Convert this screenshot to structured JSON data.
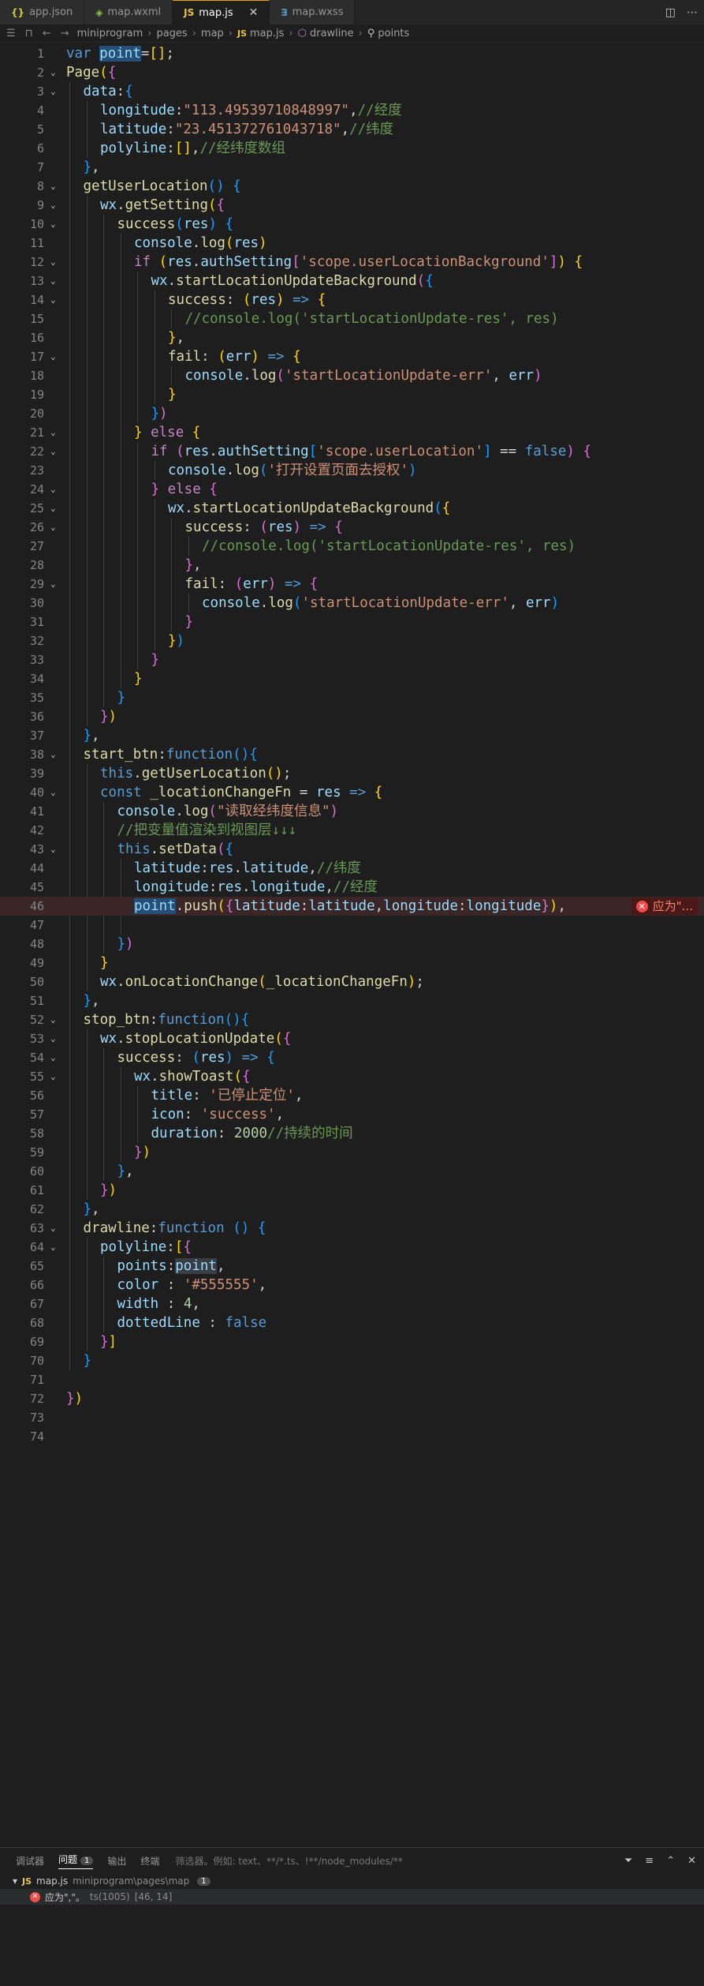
{
  "tabs": [
    {
      "label": "app.json",
      "icon": "{}"
    },
    {
      "label": "map.wxml",
      "icon": "◈"
    },
    {
      "label": "map.js",
      "icon": "JS",
      "active": true
    },
    {
      "label": "map.wxss",
      "icon": "∃"
    }
  ],
  "tab_close": "✕",
  "breadcrumb": {
    "items": [
      "miniprogram",
      "pages",
      "map",
      "map.js",
      "drawline",
      "points"
    ]
  },
  "error_badge": "应为\"...",
  "code_lines": [
    {
      "n": "1",
      "indent": 0,
      "fold": "",
      "html": "<span class='kw'>var</span> <span class='var hl'>point</span><span class='pn'>=</span><span class='p1'>[]</span><span class='pn'>;</span>"
    },
    {
      "n": "2",
      "indent": 0,
      "fold": "v",
      "html": "<span class='fn'>Page</span><span class='p1'>(</span><span class='p2'>{</span>"
    },
    {
      "n": "3",
      "indent": 1,
      "fold": "v",
      "html": "<span class='var'>data</span><span class='pn'>:</span><span class='p3'>{</span>"
    },
    {
      "n": "4",
      "indent": 2,
      "fold": "",
      "html": "<span class='var'>longitude</span><span class='pn'>:</span><span class='str'>\"113.49539710848997\"</span><span class='pn'>,</span><span class='cm'>//经度</span>"
    },
    {
      "n": "5",
      "indent": 2,
      "fold": "",
      "html": "<span class='var'>latitude</span><span class='pn'>:</span><span class='str'>\"23.451372761043718\"</span><span class='pn'>,</span><span class='cm'>//纬度</span>"
    },
    {
      "n": "6",
      "indent": 2,
      "fold": "",
      "html": "<span class='var'>polyline</span><span class='pn'>:</span><span class='p1'>[]</span><span class='pn'>,</span><span class='cm'>//经纬度数组</span>"
    },
    {
      "n": "7",
      "indent": 1,
      "fold": "",
      "html": "<span class='p3'>}</span><span class='pn'>,</span>"
    },
    {
      "n": "8",
      "indent": 1,
      "fold": "v",
      "html": "<span class='fn'>getUserLocation</span><span class='p3'>()</span> <span class='p3'>{</span>"
    },
    {
      "n": "9",
      "indent": 2,
      "fold": "v",
      "html": "<span class='var'>wx</span><span class='pn'>.</span><span class='fn'>getSetting</span><span class='p1'>(</span><span class='p2'>{</span>"
    },
    {
      "n": "10",
      "indent": 3,
      "fold": "v",
      "html": "<span class='fn'>success</span><span class='p3'>(</span><span class='var'>res</span><span class='p3'>)</span> <span class='p3'>{</span>"
    },
    {
      "n": "11",
      "indent": 4,
      "fold": "",
      "html": "<span class='var'>console</span><span class='pn'>.</span><span class='fn'>log</span><span class='p1'>(</span><span class='var'>res</span><span class='p1'>)</span>"
    },
    {
      "n": "12",
      "indent": 4,
      "fold": "v",
      "html": "<span class='ctl'>if</span> <span class='p1'>(</span><span class='var'>res</span><span class='pn'>.</span><span class='var'>authSetting</span><span class='p2'>[</span><span class='str'>'scope.userLocationBackground'</span><span class='p2'>]</span><span class='p1'>)</span> <span class='p1'>{</span>"
    },
    {
      "n": "13",
      "indent": 5,
      "fold": "v",
      "html": "<span class='var'>wx</span><span class='pn'>.</span><span class='fn'>startLocationUpdateBackground</span><span class='p2'>(</span><span class='p3'>{</span>"
    },
    {
      "n": "14",
      "indent": 6,
      "fold": "v",
      "html": "<span class='fn'>success</span><span class='pn'>:</span> <span class='p1'>(</span><span class='var'>res</span><span class='p1'>)</span> <span class='kw'>=></span> <span class='p1'>{</span>"
    },
    {
      "n": "15",
      "indent": 7,
      "fold": "",
      "html": "<span class='cm'>//console.log('startLocationUpdate-res', res)</span>"
    },
    {
      "n": "16",
      "indent": 6,
      "fold": "",
      "html": "<span class='p1'>}</span><span class='pn'>,</span>"
    },
    {
      "n": "17",
      "indent": 6,
      "fold": "v",
      "html": "<span class='fn'>fail</span><span class='pn'>:</span> <span class='p1'>(</span><span class='var'>err</span><span class='p1'>)</span> <span class='kw'>=></span> <span class='p1'>{</span>"
    },
    {
      "n": "18",
      "indent": 7,
      "fold": "",
      "html": "<span class='var'>console</span><span class='pn'>.</span><span class='fn'>log</span><span class='p2'>(</span><span class='str'>'startLocationUpdate-err'</span><span class='pn'>,</span> <span class='var'>err</span><span class='p2'>)</span>"
    },
    {
      "n": "19",
      "indent": 6,
      "fold": "",
      "html": "<span class='p1'>}</span>"
    },
    {
      "n": "20",
      "indent": 5,
      "fold": "",
      "html": "<span class='p3'>}</span><span class='p2'>)</span>"
    },
    {
      "n": "21",
      "indent": 4,
      "fold": "v",
      "html": "<span class='p1'>}</span> <span class='ctl'>else</span> <span class='p1'>{</span>"
    },
    {
      "n": "22",
      "indent": 5,
      "fold": "v",
      "html": "<span class='ctl'>if</span> <span class='p2'>(</span><span class='var'>res</span><span class='pn'>.</span><span class='var'>authSetting</span><span class='p3'>[</span><span class='str'>'scope.userLocation'</span><span class='p3'>]</span> <span class='pn'>==</span> <span class='kw'>false</span><span class='p2'>)</span> <span class='p2'>{</span>"
    },
    {
      "n": "23",
      "indent": 6,
      "fold": "",
      "html": "<span class='var'>console</span><span class='pn'>.</span><span class='fn'>log</span><span class='p3'>(</span><span class='str'>'打开设置页面去授权'</span><span class='p3'>)</span>"
    },
    {
      "n": "24",
      "indent": 5,
      "fold": "v",
      "html": "<span class='p2'>}</span> <span class='ctl'>else</span> <span class='p2'>{</span>"
    },
    {
      "n": "25",
      "indent": 6,
      "fold": "v",
      "html": "<span class='var'>wx</span><span class='pn'>.</span><span class='fn'>startLocationUpdateBackground</span><span class='p3'>(</span><span class='p1'>{</span>"
    },
    {
      "n": "26",
      "indent": 7,
      "fold": "v",
      "html": "<span class='fn'>success</span><span class='pn'>:</span> <span class='p2'>(</span><span class='var'>res</span><span class='p2'>)</span> <span class='kw'>=></span> <span class='p2'>{</span>"
    },
    {
      "n": "27",
      "indent": 8,
      "fold": "",
      "html": "<span class='cm'>//console.log('startLocationUpdate-res', res)</span>"
    },
    {
      "n": "28",
      "indent": 7,
      "fold": "",
      "html": "<span class='p2'>}</span><span class='pn'>,</span>"
    },
    {
      "n": "29",
      "indent": 7,
      "fold": "v",
      "html": "<span class='fn'>fail</span><span class='pn'>:</span> <span class='p2'>(</span><span class='var'>err</span><span class='p2'>)</span> <span class='kw'>=></span> <span class='p2'>{</span>"
    },
    {
      "n": "30",
      "indent": 8,
      "fold": "",
      "html": "<span class='var'>console</span><span class='pn'>.</span><span class='fn'>log</span><span class='p3'>(</span><span class='str'>'startLocationUpdate-err'</span><span class='pn'>,</span> <span class='var'>err</span><span class='p3'>)</span>"
    },
    {
      "n": "31",
      "indent": 7,
      "fold": "",
      "html": "<span class='p2'>}</span>"
    },
    {
      "n": "32",
      "indent": 6,
      "fold": "",
      "html": "<span class='p1'>}</span><span class='p3'>)</span>"
    },
    {
      "n": "33",
      "indent": 5,
      "fold": "",
      "html": "<span class='p2'>}</span>"
    },
    {
      "n": "34",
      "indent": 4,
      "fold": "",
      "html": "<span class='p1'>}</span>"
    },
    {
      "n": "35",
      "indent": 3,
      "fold": "",
      "html": "<span class='p3'>}</span>"
    },
    {
      "n": "36",
      "indent": 2,
      "fold": "",
      "html": "<span class='p2'>}</span><span class='p1'>)</span>"
    },
    {
      "n": "37",
      "indent": 1,
      "fold": "",
      "html": "<span class='p3'>}</span><span class='pn'>,</span>"
    },
    {
      "n": "38",
      "indent": 1,
      "fold": "v",
      "html": "<span class='fn'>start_btn</span><span class='pn'>:</span><span class='kw'>function</span><span class='p3'>()</span><span class='p3'>{</span>"
    },
    {
      "n": "39",
      "indent": 2,
      "fold": "",
      "html": "<span class='kw'>this</span><span class='pn'>.</span><span class='fn'>getUserLocation</span><span class='p1'>()</span><span class='pn'>;</span>"
    },
    {
      "n": "40",
      "indent": 2,
      "fold": "v",
      "html": "<span class='kw'>const</span> <span class='fn'>_locationChangeFn</span> <span class='pn'>=</span> <span class='var'>res</span> <span class='kw'>=></span> <span class='p1'>{</span>"
    },
    {
      "n": "41",
      "indent": 3,
      "fold": "",
      "html": "<span class='var'>console</span><span class='pn'>.</span><span class='fn'>log</span><span class='p2'>(</span><span class='str'>\"读取经纬度信息\"</span><span class='p2'>)</span>"
    },
    {
      "n": "42",
      "indent": 3,
      "fold": "",
      "html": "<span class='cm'>//把变量值渲染到视图层↓↓↓</span>"
    },
    {
      "n": "43",
      "indent": 3,
      "fold": "v",
      "html": "<span class='kw'>this</span><span class='pn'>.</span><span class='fn'>setData</span><span class='p2'>(</span><span class='p3'>{</span>"
    },
    {
      "n": "44",
      "indent": 4,
      "fold": "",
      "html": "<span class='var'>latitude</span><span class='pn'>:</span><span class='var'>res</span><span class='pn'>.</span><span class='var'>latitude</span><span class='pn'>,</span><span class='cm'>//纬度</span>"
    },
    {
      "n": "45",
      "indent": 4,
      "fold": "",
      "html": "<span class='var'>longitude</span><span class='pn'>:</span><span class='var'>res</span><span class='pn'>.</span><span class='var'>longitude</span><span class='pn'>,</span><span class='cm'>//经度</span>"
    },
    {
      "n": "46",
      "indent": 4,
      "fold": "",
      "err": true,
      "html": "<span class='var hl'>point</span><span class='pn'>.</span><span class='fn'>push</span><span class='p1'>(</span><span class='p2'>{</span><span class='var'>latitude</span><span class='pn'>:</span><span class='var'>latitude</span><span class='pn'>,</span><span class='var'>longitude</span><span class='pn'>:</span><span class='var'>longitude</span><span class='p2'>}</span><span class='p1'>)</span><span class='pn'>,</span>"
    },
    {
      "n": "47",
      "indent": 4,
      "fold": "",
      "html": ""
    },
    {
      "n": "48",
      "indent": 3,
      "fold": "",
      "html": "<span class='p3'>}</span><span class='p2'>)</span>"
    },
    {
      "n": "49",
      "indent": 2,
      "fold": "",
      "html": "<span class='p1'>}</span>"
    },
    {
      "n": "50",
      "indent": 2,
      "fold": "",
      "html": "<span class='var'>wx</span><span class='pn'>.</span><span class='fn'>onLocationChange</span><span class='p1'>(</span><span class='fn'>_locationChangeFn</span><span class='p1'>)</span><span class='pn'>;</span>"
    },
    {
      "n": "51",
      "indent": 1,
      "fold": "",
      "html": "<span class='p3'>}</span><span class='pn'>,</span>"
    },
    {
      "n": "52",
      "indent": 1,
      "fold": "v",
      "html": "<span class='fn'>stop_btn</span><span class='pn'>:</span><span class='kw'>function</span><span class='p3'>()</span><span class='p3'>{</span>"
    },
    {
      "n": "53",
      "indent": 2,
      "fold": "v",
      "html": "<span class='var'>wx</span><span class='pn'>.</span><span class='fn'>stopLocationUpdate</span><span class='p1'>(</span><span class='p2'>{</span>"
    },
    {
      "n": "54",
      "indent": 3,
      "fold": "v",
      "html": "<span class='fn'>success</span><span class='pn'>:</span> <span class='p3'>(</span><span class='var'>res</span><span class='p3'>)</span> <span class='kw'>=></span> <span class='p3'>{</span>"
    },
    {
      "n": "55",
      "indent": 4,
      "fold": "v",
      "html": "<span class='var'>wx</span><span class='pn'>.</span><span class='fn'>showToast</span><span class='p1'>(</span><span class='p2'>{</span>"
    },
    {
      "n": "56",
      "indent": 5,
      "fold": "",
      "html": "<span class='var'>title</span><span class='pn'>:</span> <span class='str'>'已停止定位'</span><span class='pn'>,</span>"
    },
    {
      "n": "57",
      "indent": 5,
      "fold": "",
      "html": "<span class='var'>icon</span><span class='pn'>:</span> <span class='str'>'success'</span><span class='pn'>,</span>"
    },
    {
      "n": "58",
      "indent": 5,
      "fold": "",
      "html": "<span class='var'>duration</span><span class='pn'>:</span> <span class='num'>2000</span><span class='cm'>//持续的时间</span>"
    },
    {
      "n": "59",
      "indent": 4,
      "fold": "",
      "html": "<span class='p2'>}</span><span class='p1'>)</span>"
    },
    {
      "n": "60",
      "indent": 3,
      "fold": "",
      "html": "<span class='p3'>}</span><span class='pn'>,</span>"
    },
    {
      "n": "61",
      "indent": 2,
      "fold": "",
      "html": "<span class='p2'>}</span><span class='p1'>)</span>"
    },
    {
      "n": "62",
      "indent": 1,
      "fold": "",
      "html": "<span class='p3'>}</span><span class='pn'>,</span>"
    },
    {
      "n": "63",
      "indent": 1,
      "fold": "v",
      "html": "<span class='fn'>drawline</span><span class='pn'>:</span><span class='kw'>function</span> <span class='p3'>()</span> <span class='p3'>{</span>"
    },
    {
      "n": "64",
      "indent": 2,
      "fold": "v",
      "html": "<span class='var'>polyline</span><span class='pn'>:</span><span class='p1'>[</span><span class='p2'>{</span>"
    },
    {
      "n": "65",
      "indent": 3,
      "fold": "",
      "html": "<span class='var'>points</span><span class='pn'>:</span><span class='var sel'>point</span><span class='pn'>,</span>"
    },
    {
      "n": "66",
      "indent": 3,
      "fold": "",
      "html": "<span class='var'>color</span> <span class='pn'>:</span> <span class='str'>'#555555'</span><span class='pn'>,</span>"
    },
    {
      "n": "67",
      "indent": 3,
      "fold": "",
      "html": "<span class='var'>width</span> <span class='pn'>:</span> <span class='num'>4</span><span class='pn'>,</span>"
    },
    {
      "n": "68",
      "indent": 3,
      "fold": "",
      "html": "<span class='var'>dottedLine</span> <span class='pn'>:</span> <span class='kw'>false</span>"
    },
    {
      "n": "69",
      "indent": 2,
      "fold": "",
      "html": "<span class='p2'>}</span><span class='p1'>]</span>"
    },
    {
      "n": "70",
      "indent": 1,
      "fold": "",
      "html": "<span class='p3'>}</span>"
    },
    {
      "n": "71",
      "indent": 0,
      "fold": "",
      "html": ""
    },
    {
      "n": "72",
      "indent": 0,
      "fold": "",
      "html": "<span class='p2'>}</span><span class='p1'>)</span>"
    },
    {
      "n": "73",
      "indent": 0,
      "fold": "",
      "html": ""
    },
    {
      "n": "74",
      "indent": 0,
      "fold": "",
      "html": ""
    }
  ],
  "panel": {
    "tabs": [
      "调试器",
      "问题",
      "输出",
      "终端"
    ],
    "problem_count": "1",
    "filter_placeholder": "筛选器。例如: text、**/*.ts、!**/node_modules/**",
    "file_name": "map.js",
    "file_path": "miniprogram\\pages\\map",
    "file_count": "1",
    "problem_text": "应为\",\"。",
    "problem_code": "ts(1005)",
    "problem_loc": "[46, 14]"
  },
  "colors": {
    "background": "#1e1e1e",
    "keyword": "#569cd6",
    "function": "#dcdcaa",
    "string": "#ce9178",
    "comment": "#6a9955",
    "error": "#f14c4c"
  }
}
